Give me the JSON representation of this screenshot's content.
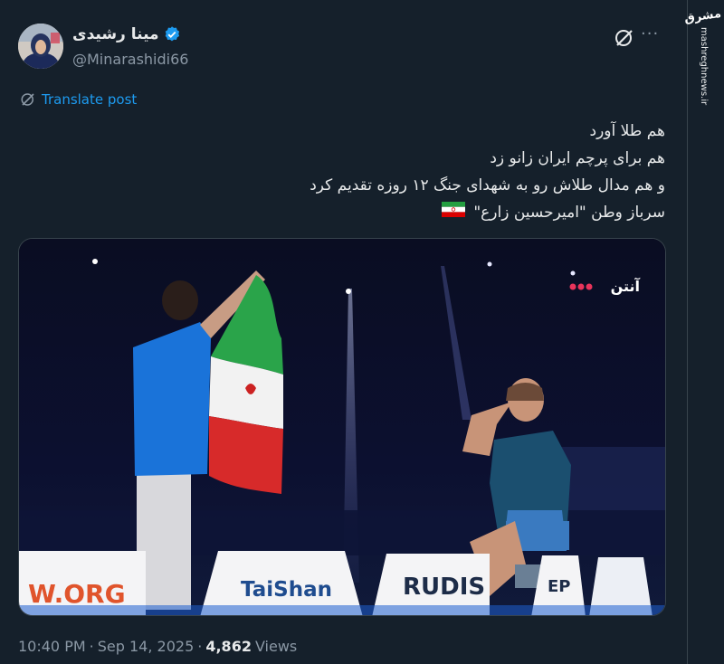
{
  "author": {
    "name": "مینا رشیدی",
    "handle": "@Minarashidi66",
    "verified": true
  },
  "header": {
    "grok_icon": "grok-icon",
    "more_icon": "more-icon",
    "more_label": "···"
  },
  "translate_label": "Translate post",
  "post_lines": [
    "هم طلا آورد",
    "هم برای پرچم ایران زانو زد",
    "و هم مدال طلاش رو به شهدای جنگ ۱۲ روزه تقدیم کرد",
    "سرباز وطن \"امیرحسین زارع\""
  ],
  "media": {
    "channel_logo": "آنتن",
    "banners": [
      "W.ORG",
      "TaiShan",
      "RUDIS",
      "EP"
    ]
  },
  "meta": {
    "time": "10:40 PM",
    "separator": "·",
    "date": "Sep 14, 2025",
    "views_count": "4,862",
    "views_label": "Views"
  },
  "watermark": {
    "logo": "مشرق",
    "url": "mashreghnews.ir"
  },
  "colors": {
    "background": "#15202b",
    "accent": "#1d9bf0",
    "secondary_text": "#8b98a5"
  }
}
